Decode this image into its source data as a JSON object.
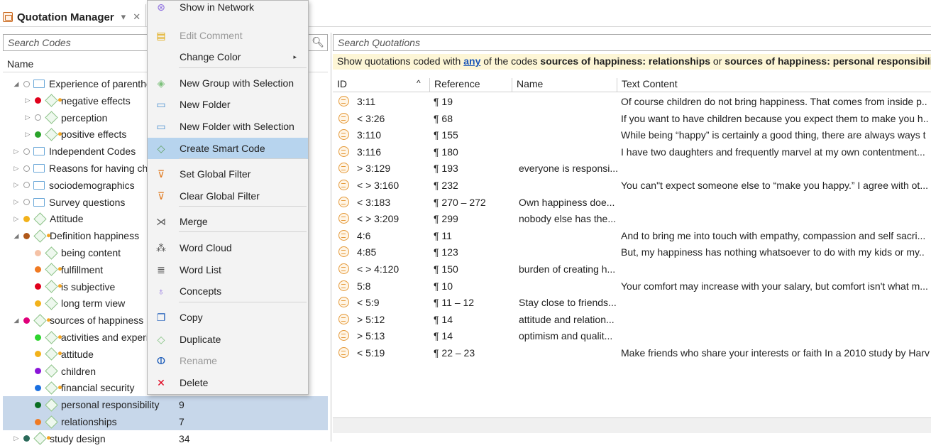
{
  "tab": {
    "title": "Quotation Manager",
    "dropdown": "▾",
    "close": "✕"
  },
  "left": {
    "search_placeholder": "Search Codes",
    "column_name": "Name",
    "rows": [
      {
        "indent": 0,
        "exp": "◢",
        "dot": "o",
        "icon": "folder",
        "label": "Experience of parentho",
        "num": ""
      },
      {
        "indent": 1,
        "exp": "▷",
        "dot": "#e0001b",
        "icon": "code-s",
        "label": "negative effects",
        "num": ""
      },
      {
        "indent": 1,
        "exp": "▷",
        "dot": "o",
        "icon": "code",
        "label": "perception",
        "num": ""
      },
      {
        "indent": 1,
        "exp": "▷",
        "dot": "#2aa32a",
        "icon": "code-s",
        "label": "positive effects",
        "num": ""
      },
      {
        "indent": 0,
        "exp": "▷",
        "dot": "o",
        "icon": "folder",
        "label": "Independent Codes",
        "num": ""
      },
      {
        "indent": 0,
        "exp": "▷",
        "dot": "o",
        "icon": "folder",
        "label": "Reasons for having chil",
        "num": ""
      },
      {
        "indent": 0,
        "exp": "▷",
        "dot": "o",
        "icon": "folder",
        "label": "sociodemographics",
        "num": ""
      },
      {
        "indent": 0,
        "exp": "▷",
        "dot": "o",
        "icon": "folder",
        "label": "Survey questions",
        "num": ""
      },
      {
        "indent": 0,
        "exp": "▷",
        "dot": "#f2b21b",
        "icon": "code",
        "label": "Attitude",
        "num": ""
      },
      {
        "indent": 0,
        "exp": "◢",
        "dot": "#b0581a",
        "icon": "code-s",
        "label": "Definition happiness",
        "num": ""
      },
      {
        "indent": 1,
        "exp": "",
        "dot": "#f5c2a6",
        "icon": "code",
        "label": "being content",
        "num": ""
      },
      {
        "indent": 1,
        "exp": "",
        "dot": "#f07a22",
        "icon": "code-s",
        "label": "fulfillment",
        "num": ""
      },
      {
        "indent": 1,
        "exp": "",
        "dot": "#e0001b",
        "icon": "code-s",
        "label": "is subjective",
        "num": ""
      },
      {
        "indent": 1,
        "exp": "",
        "dot": "#f2b21b",
        "icon": "code",
        "label": "long term view",
        "num": ""
      },
      {
        "indent": 0,
        "exp": "◢",
        "dot": "#e0007a",
        "icon": "code-s",
        "label": "sources of happiness",
        "num": ""
      },
      {
        "indent": 1,
        "exp": "",
        "dot": "#2ed42e",
        "icon": "code-s",
        "label": "activities and experie",
        "num": ""
      },
      {
        "indent": 1,
        "exp": "",
        "dot": "#f2b21b",
        "icon": "code-s",
        "label": "attitude",
        "num": ""
      },
      {
        "indent": 1,
        "exp": "",
        "dot": "#8a14d8",
        "icon": "code",
        "label": "children",
        "num": ""
      },
      {
        "indent": 1,
        "exp": "",
        "dot": "#1a6fe0",
        "icon": "code-s",
        "label": "financial security",
        "num": ""
      },
      {
        "indent": 1,
        "exp": "",
        "dot": "#0a6e22",
        "icon": "code",
        "label": "personal responsibility",
        "num": "9",
        "sel": true
      },
      {
        "indent": 1,
        "exp": "",
        "dot": "#f07a22",
        "icon": "code",
        "label": "relationships",
        "num": "7",
        "sel": true
      },
      {
        "indent": 0,
        "exp": "▷",
        "dot": "#2a6a5a",
        "icon": "code-s",
        "label": "study design",
        "num": "34"
      }
    ]
  },
  "menu": {
    "items": [
      {
        "label": "Show in Network",
        "icon": "network-icon",
        "glyph": "⊛",
        "color": "#8a6adf",
        "dis": false
      },
      {
        "label": "Edit Comment",
        "icon": "comment-icon",
        "glyph": "▤",
        "color": "#e0a400",
        "dis": true
      },
      {
        "label": "Change Color",
        "icon": "color-icon",
        "glyph": "",
        "color": "#333",
        "dis": false,
        "submenu": "▸"
      },
      {
        "label": "New Group with Selection",
        "icon": "group-icon",
        "glyph": "◈",
        "color": "#7cc07a",
        "dis": false
      },
      {
        "label": "New Folder",
        "icon": "folder-icon",
        "glyph": "▭",
        "color": "#4a90d0",
        "dis": false
      },
      {
        "label": "New Folder with Selection",
        "icon": "folder-selection-icon",
        "glyph": "▭",
        "color": "#4a90d0",
        "dis": false
      },
      {
        "label": "Create Smart Code",
        "icon": "smart-code-icon",
        "glyph": "◇",
        "color": "#5a9e5a",
        "dis": false,
        "hl": true
      },
      {
        "label": "Set Global Filter",
        "icon": "filter-icon",
        "glyph": "⊽",
        "color": "#e07a20",
        "dis": false
      },
      {
        "label": "Clear Global Filter",
        "icon": "clear-filter-icon",
        "glyph": "⊽",
        "color": "#e07a20",
        "dis": false
      },
      {
        "label": "Merge",
        "icon": "merge-icon",
        "glyph": "⋊",
        "color": "#555",
        "dis": false
      },
      {
        "label": "Word Cloud",
        "icon": "word-cloud-icon",
        "glyph": "⁂",
        "color": "#555",
        "dis": false
      },
      {
        "label": "Word List",
        "icon": "word-list-icon",
        "glyph": "≣",
        "color": "#555",
        "dis": false
      },
      {
        "label": "Concepts",
        "icon": "concepts-icon",
        "glyph": "♁",
        "color": "#8a6adf",
        "dis": false
      },
      {
        "label": "Copy",
        "icon": "copy-icon",
        "glyph": "❐",
        "color": "#1a5ab8",
        "dis": false
      },
      {
        "label": "Duplicate",
        "icon": "duplicate-icon",
        "glyph": "◇",
        "color": "#7cc07a",
        "dis": false
      },
      {
        "label": "Rename",
        "icon": "rename-icon",
        "glyph": "ⵀ",
        "color": "#1a5ab8",
        "dis": true
      },
      {
        "label": "Delete",
        "icon": "delete-icon",
        "glyph": "✕",
        "color": "#e0001b",
        "dis": false
      }
    ]
  },
  "right": {
    "search_placeholder": "Search Quotations",
    "filter": {
      "prefix": "Show quotations coded with ",
      "mode": "any",
      "mid": " of the codes ",
      "code1": "sources of happiness: relationships",
      "or": " or ",
      "code2": "sources of happiness: personal responsibility"
    },
    "columns": {
      "id": "ID",
      "sort": "^",
      "reference": "Reference",
      "name": "Name",
      "text": "Text Content"
    },
    "rows": [
      {
        "id": "3:11",
        "ref": "¶ 19",
        "name": "",
        "text": "Of course children do not bring happiness. That comes from inside p.."
      },
      {
        "id": "< 3:26",
        "ref": "¶ 68",
        "name": "",
        "text": "If you want to have children because you expect them to make you h.."
      },
      {
        "id": "3:110",
        "ref": "¶ 155",
        "name": "",
        "text": "While being “happy” is certainly a good thing, there are always ways t"
      },
      {
        "id": "3:116",
        "ref": "¶ 180",
        "name": "",
        "text": "I have two daughters and frequently marvel at my own contentment..."
      },
      {
        "id": "> 3:129",
        "ref": "¶ 193",
        "name": "everyone is responsi...",
        "text": ""
      },
      {
        "id": "< > 3:160",
        "ref": "¶ 232",
        "name": "",
        "text": "You can\"t expect someone else to “make you happy.” I agree with ot..."
      },
      {
        "id": "< 3:183",
        "ref": "¶ 270 – 272",
        "name": "Own happiness doe...",
        "text": ""
      },
      {
        "id": "< > 3:209",
        "ref": "¶ 299",
        "name": "nobody else has the...",
        "text": ""
      },
      {
        "id": "4:6",
        "ref": "¶ 11",
        "name": "",
        "text": "And to bring me into touch with empathy, compassion and self sacri..."
      },
      {
        "id": "4:85",
        "ref": "¶ 123",
        "name": "",
        "text": "But, my happiness has nothing whatsoever to do with my kids or my.."
      },
      {
        "id": "< > 4:120",
        "ref": "¶ 150",
        "name": "burden of creating h...",
        "text": ""
      },
      {
        "id": "5:8",
        "ref": "¶ 10",
        "name": "",
        "text": "Your comfort may increase with your salary, but comfort isn't what m..."
      },
      {
        "id": "< 5:9",
        "ref": "¶ 11 – 12",
        "name": "Stay close to friends...",
        "text": ""
      },
      {
        "id": "> 5:12",
        "ref": "¶ 14",
        "name": "attitude and relation...",
        "text": ""
      },
      {
        "id": "> 5:13",
        "ref": "¶ 14",
        "name": "optimism and qualit...",
        "text": ""
      },
      {
        "id": "< 5:19",
        "ref": "¶ 22 – 23",
        "name": "",
        "text": "Make friends who share your interests or faith In a 2010 study by Harv"
      }
    ]
  }
}
